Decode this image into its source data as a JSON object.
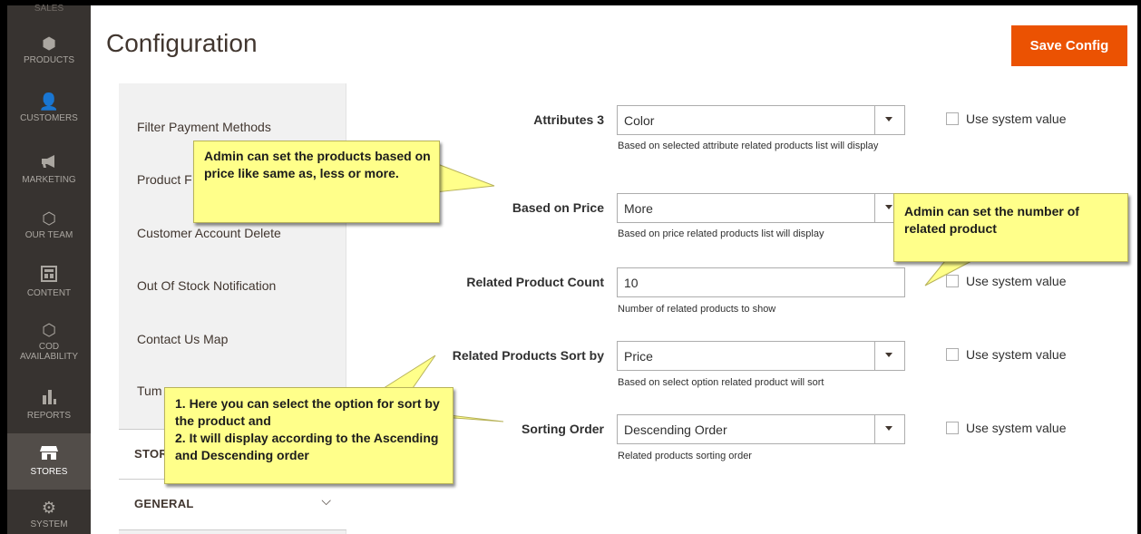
{
  "menu": {
    "top_cut_label": "SALES",
    "items": [
      {
        "label": "PRODUCTS",
        "icon": "cube-icon"
      },
      {
        "label": "CUSTOMERS",
        "icon": "person-icon"
      },
      {
        "label": "MARKETING",
        "icon": "megaphone-icon"
      },
      {
        "label": "OUR TEAM",
        "icon": "hexagon-icon"
      },
      {
        "label": "CONTENT",
        "icon": "layout-icon"
      },
      {
        "label": "COD AVAILABILITY",
        "icon": "hexagon-icon"
      },
      {
        "label": "REPORTS",
        "icon": "bar-chart-icon"
      },
      {
        "label": "STORES",
        "icon": "store-icon"
      },
      {
        "label": "SYSTEM",
        "icon": "gear-icon"
      }
    ]
  },
  "header": {
    "title": "Configuration",
    "save_label": "Save Config"
  },
  "tabs": {
    "links": [
      "Filter Payment Methods",
      "Product F",
      "Customer Account Delete",
      "Out Of Stock Notification",
      "Contact Us Map",
      "Tum"
    ],
    "sections": [
      {
        "label": "STOR"
      },
      {
        "label": "GENERAL",
        "chevron": "chevron-down-icon"
      }
    ]
  },
  "form": {
    "attributes3": {
      "label": "Attributes 3",
      "value": "Color",
      "note": "Based on selected attribute related products list will display",
      "system": "Use system value"
    },
    "based_on_price": {
      "label": "Based on Price",
      "value": "More",
      "note": "Based on price related products list will display"
    },
    "related_count": {
      "label": "Related Product Count",
      "value": "10",
      "note": "Number of related products to show",
      "system": "Use system value"
    },
    "sort_by": {
      "label": "Related Products Sort by",
      "value": "Price",
      "note": "Based on select option related product will sort",
      "system": "Use system value"
    },
    "sorting_order": {
      "label": "Sorting Order",
      "value": "Descending Order",
      "note": "Related products sorting order",
      "system": "Use system value"
    }
  },
  "callouts": {
    "price": "Admin can set the products based on price like same as, less or more.",
    "count": "Admin can set the number of related product",
    "sort": "1. Here you can select the option for sort by the product and\n2. It will display according to the Ascending and Descending order"
  },
  "colors": {
    "menu_bg": "#373330",
    "accent": "#eb5202",
    "callout_bg": "#ffff8a"
  }
}
